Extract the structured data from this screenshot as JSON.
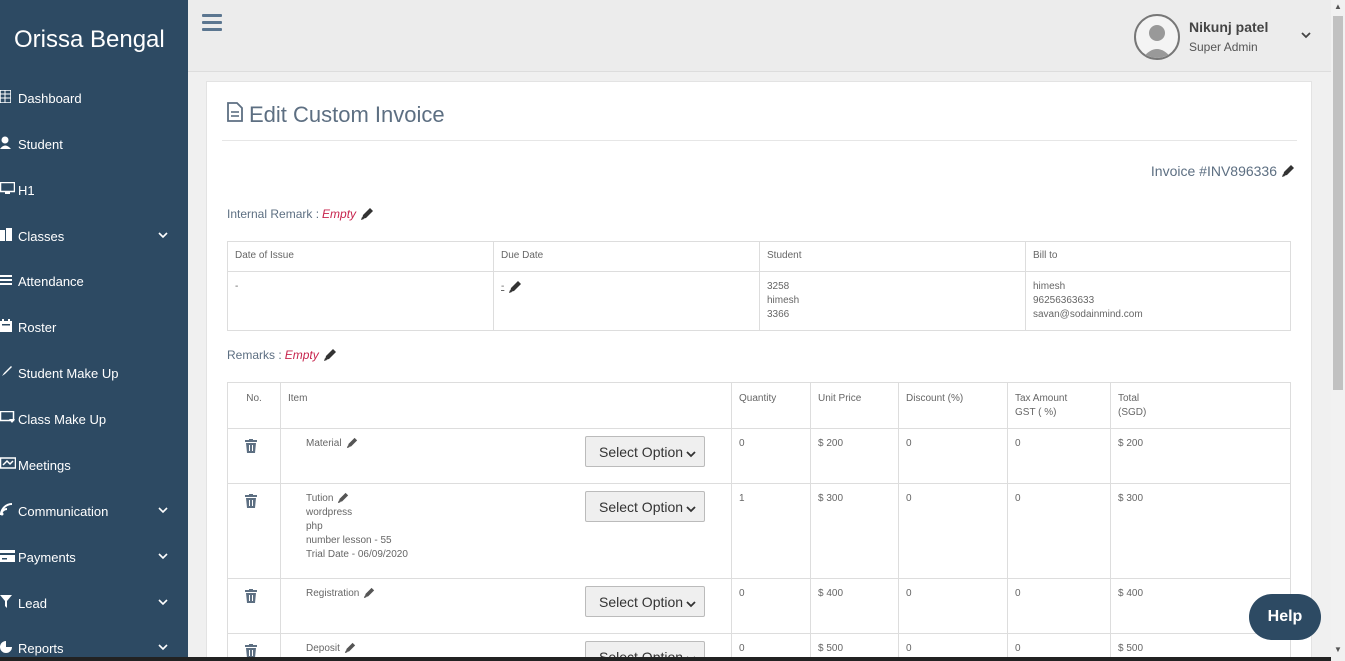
{
  "brand": "Orissa Bengal",
  "sidebar": {
    "items": [
      {
        "label": "Dashboard",
        "icon": "dashboard-icon",
        "has_children": false
      },
      {
        "label": "Student",
        "icon": "student-icon",
        "has_children": false
      },
      {
        "label": "H1",
        "icon": "monitor-icon",
        "has_children": false
      },
      {
        "label": "Classes",
        "icon": "book-icon",
        "has_children": true
      },
      {
        "label": "Attendance",
        "icon": "list-icon",
        "has_children": false
      },
      {
        "label": "Roster",
        "icon": "calendar-icon",
        "has_children": false
      },
      {
        "label": "Student Make Up",
        "icon": "rocket-icon",
        "has_children": false
      },
      {
        "label": "Class Make Up",
        "icon": "classroom-icon",
        "has_children": false
      },
      {
        "label": "Meetings",
        "icon": "meetings-icon",
        "has_children": false
      },
      {
        "label": "Communication",
        "icon": "broadcast-icon",
        "has_children": true
      },
      {
        "label": "Payments",
        "icon": "credit-card-icon",
        "has_children": true
      },
      {
        "label": "Lead",
        "icon": "filter-icon",
        "has_children": true
      },
      {
        "label": "Reports",
        "icon": "chart-icon",
        "has_children": true
      }
    ]
  },
  "user": {
    "name": "Nikunj patel",
    "role": "Super Admin"
  },
  "page": {
    "title": "Edit Custom Invoice",
    "invoice_number": "Invoice #INV896336",
    "internal_remark_label": "Internal Remark :",
    "internal_remark_value": "Empty",
    "remarks_label": "Remarks :",
    "remarks_value": "Empty"
  },
  "info_table": {
    "headers": [
      "Date of Issue",
      "Due Date",
      "Student",
      "Bill to"
    ],
    "date_of_issue": "-",
    "due_date": "-",
    "student": [
      "3258",
      "himesh",
      "3366"
    ],
    "bill_to": [
      "himesh",
      "96256363633",
      "savan@sodainmind.com"
    ]
  },
  "items_table": {
    "headers": {
      "no": "No.",
      "item": "Item",
      "quantity": "Quantity",
      "unit_price": "Unit Price",
      "discount": "Discount (%)",
      "tax_line1": "Tax Amount",
      "tax_line2": "GST ( %)",
      "total_line1": "Total",
      "total_line2": "(SGD)"
    },
    "select_label": "Select Option",
    "rows": [
      {
        "name": "Material",
        "details": [],
        "quantity": "0",
        "unit_price": "$ 200",
        "discount": "0",
        "tax": "0",
        "total": "$ 200"
      },
      {
        "name": "Tution",
        "details": [
          "wordpress",
          "php",
          "number lesson - 55",
          "Trial Date - 06/09/2020"
        ],
        "quantity": "1",
        "unit_price": "$ 300",
        "discount": "0",
        "tax": "0",
        "total": "$ 300"
      },
      {
        "name": "Registration",
        "details": [],
        "quantity": "0",
        "unit_price": "$ 400",
        "discount": "0",
        "tax": "0",
        "total": "$ 400"
      },
      {
        "name": "Deposit",
        "details": [],
        "quantity": "0",
        "unit_price": "$ 500",
        "discount": "0",
        "tax": "0",
        "total": "$ 500"
      }
    ]
  },
  "help_label": "Help",
  "colors": {
    "sidebar": "#2d4a63",
    "accent": "#5d6f82",
    "empty": "#c7254e"
  }
}
